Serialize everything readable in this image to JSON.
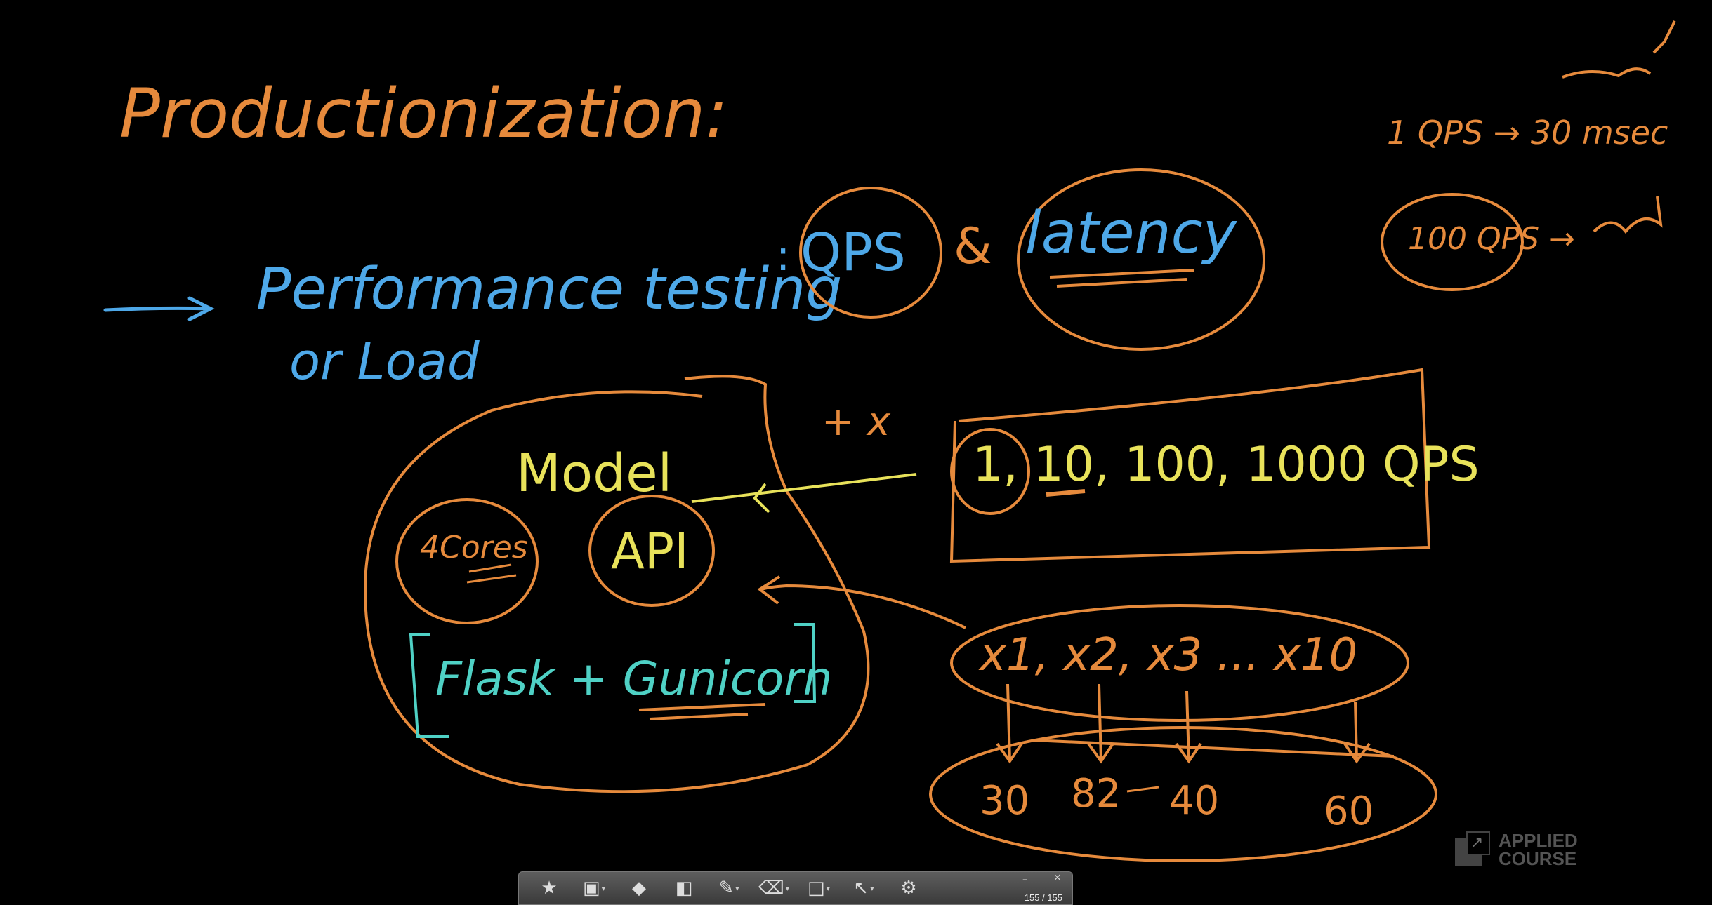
{
  "colors": {
    "background": "#000000",
    "orange": "#e68a3c",
    "blue": "#4ea8e8",
    "yellow": "#e8e25a",
    "teal": "#4fd1c5"
  },
  "notes": {
    "title": "Productionization:",
    "performance": "Performance testing",
    "colon": ":",
    "qps": "QPS",
    "amp": "&",
    "latency": "latency",
    "or_load": "or Load",
    "model": "Model",
    "cores": "4Cores",
    "api": "API",
    "flask": "Flask + Gunicorn",
    "x_label": "+ x",
    "qps_levels": "1, 10, 100, 1000 QPS",
    "xs": "x1, x2, x3 ... x10",
    "lat_30": "30",
    "lat_82": "82",
    "lat_40": "40",
    "lat_60": "60",
    "one_qps": "1 QPS → 30 msec",
    "hundred_qps": "100 QPS →"
  },
  "watermark": {
    "line1": "APPLIED",
    "line2": "COURSE"
  },
  "toolbar": {
    "tools": [
      {
        "icon": "star-icon",
        "glyph": "★"
      },
      {
        "icon": "screen-capture-icon",
        "glyph": "▣"
      },
      {
        "icon": "highlighter-icon",
        "glyph": "◆"
      },
      {
        "icon": "shape-icon",
        "glyph": "◧"
      },
      {
        "icon": "pen-icon",
        "glyph": "✎"
      },
      {
        "icon": "eraser-icon",
        "glyph": "⌫"
      },
      {
        "icon": "whiteboard-icon",
        "glyph": "□"
      },
      {
        "icon": "pointer-icon",
        "glyph": "↖"
      },
      {
        "icon": "settings-icon",
        "glyph": "⚙"
      }
    ],
    "page_counter": "155 / 155",
    "minimize": "–",
    "close": "×"
  }
}
